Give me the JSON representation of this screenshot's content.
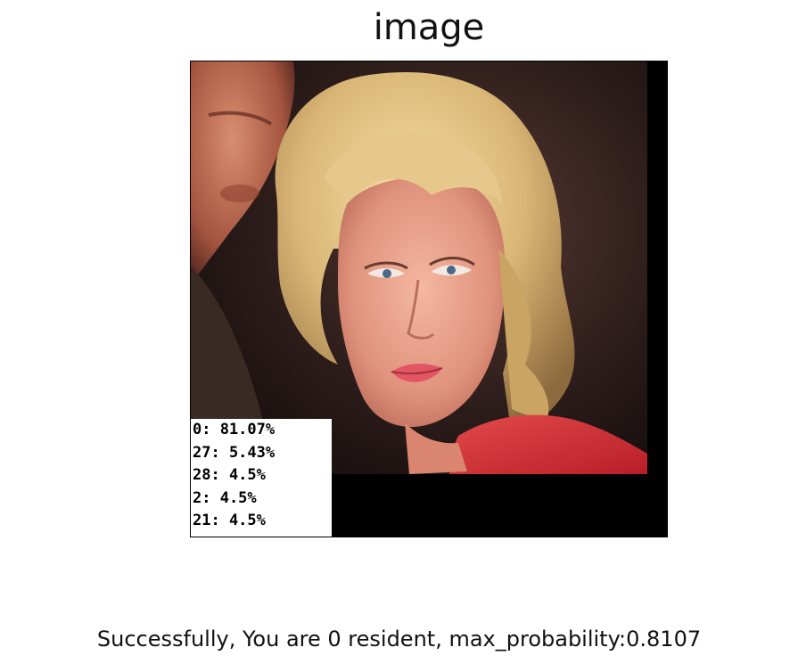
{
  "figure": {
    "title": "image"
  },
  "predictions": [
    "0: 81.07%",
    "27: 5.43%",
    "28: 4.5%",
    "2: 4.5%",
    "21: 4.5%"
  ],
  "status": {
    "message": "Successfully, You are 0 resident, max_probability:0.8107"
  }
}
